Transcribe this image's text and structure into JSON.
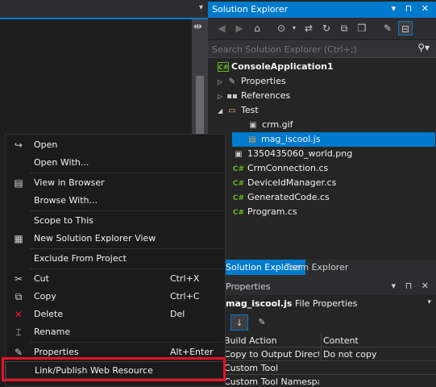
{
  "editor": {
    "tab_dropdown_glyph": "▾",
    "split_glyph": "⇹"
  },
  "solution_explorer": {
    "title": "Solution Explorer",
    "title_buttons": "▾ ⊓ ✕",
    "search_placeholder": "Search Solution Explorer (Ctrl+;)",
    "tree": [
      {
        "label": "ConsoleApplication1",
        "icon": "project-icon"
      },
      {
        "label": "Properties",
        "icon": "wrench-icon"
      },
      {
        "label": "References",
        "icon": "references-icon"
      },
      {
        "label": "Test",
        "icon": "folder-icon"
      },
      {
        "label": "crm.gif",
        "icon": "image-icon"
      },
      {
        "label": "mag_iscool.js",
        "icon": "js-file-icon",
        "selected": true
      },
      {
        "label": "1350435060_world.png",
        "icon": "image-icon"
      },
      {
        "label": "CrmConnection.cs",
        "icon": "csharp-icon"
      },
      {
        "label": "DeviceIdManager.cs",
        "icon": "csharp-icon"
      },
      {
        "label": "GeneratedCode.cs",
        "icon": "csharp-icon"
      },
      {
        "label": "Program.cs",
        "icon": "csharp-icon"
      }
    ],
    "tabs": [
      "Solution Explorer",
      "Team Explorer"
    ]
  },
  "properties": {
    "title": "Properties",
    "title_buttons": "▾ ⊓ ✕",
    "subject_name": "mag_iscool.js",
    "subject_type": "File Properties",
    "rows": [
      {
        "key": "Build Action",
        "value": "Content"
      },
      {
        "key": "Copy to Output Director",
        "value": "Do not copy"
      },
      {
        "key": "Custom Tool",
        "value": ""
      },
      {
        "key": "Custom Tool Namespace",
        "value": ""
      }
    ]
  },
  "context_menu": {
    "items": [
      {
        "label": "Open",
        "shortcut": "",
        "icon": "open-icon"
      },
      {
        "label": "Open With...",
        "shortcut": "",
        "icon": ""
      },
      {
        "label": "View in Browser",
        "shortcut": "",
        "icon": "browser-icon"
      },
      {
        "label": "Browse With...",
        "shortcut": "",
        "icon": ""
      },
      {
        "label": "Scope to This",
        "shortcut": "",
        "icon": ""
      },
      {
        "label": "New Solution Explorer View",
        "shortcut": "",
        "icon": "new-view-icon"
      },
      {
        "label": "Exclude From Project",
        "shortcut": "",
        "icon": ""
      },
      {
        "label": "Cut",
        "shortcut": "Ctrl+X",
        "icon": "scissors-icon"
      },
      {
        "label": "Copy",
        "shortcut": "Ctrl+C",
        "icon": "copy-icon"
      },
      {
        "label": "Delete",
        "shortcut": "Del",
        "icon": "delete-icon"
      },
      {
        "label": "Rename",
        "shortcut": "",
        "icon": "rename-icon"
      },
      {
        "label": "Properties",
        "shortcut": "Alt+Enter",
        "icon": "properties-icon"
      },
      {
        "label": "Link/Publish Web Resource",
        "shortcut": "",
        "icon": ""
      }
    ]
  },
  "colors": {
    "accent": "#007acc",
    "highlight_box": "#e81123",
    "menu_bg": "#1b1b1c",
    "editor_bg": "#1e1e1e"
  }
}
